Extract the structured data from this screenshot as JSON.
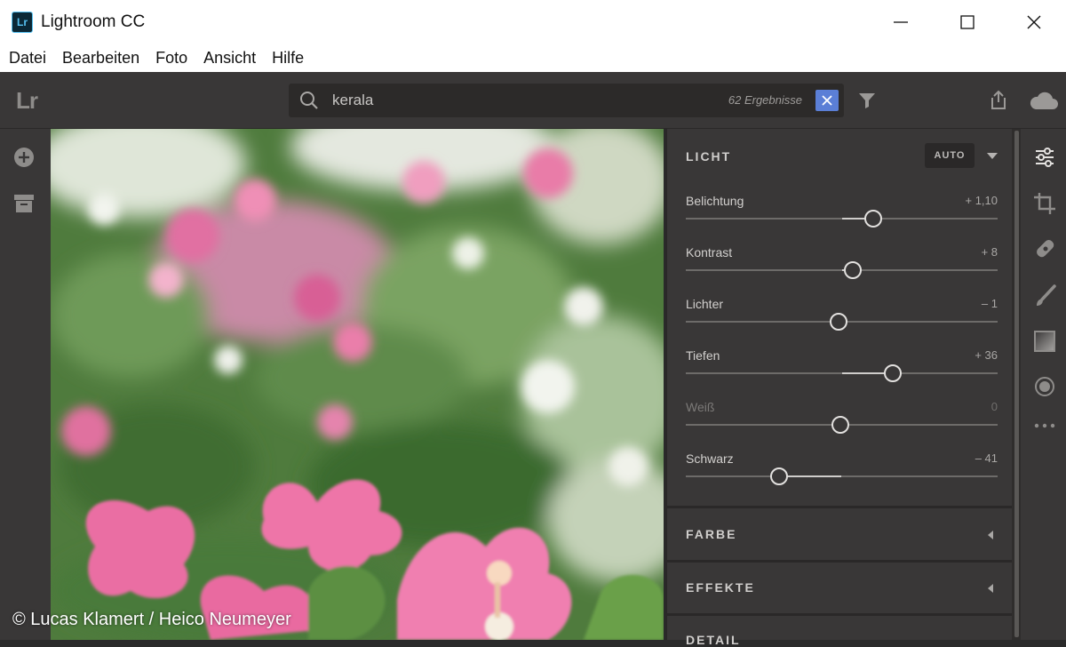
{
  "window": {
    "app_icon": "Lr",
    "title": "Lightroom CC",
    "controls": [
      "minimize-icon",
      "maximize-icon",
      "close-icon"
    ]
  },
  "menu": [
    "Datei",
    "Bearbeiten",
    "Foto",
    "Ansicht",
    "Hilfe"
  ],
  "toolbar": {
    "logo": "Lr",
    "search_value": "kerala",
    "result_count": "62 Ergebnisse",
    "icons": [
      "search-icon",
      "clear-icon",
      "filter-icon",
      "share-icon",
      "cloud-icon"
    ]
  },
  "left_sidebar": {
    "icons": [
      "add-icon",
      "archive-icon"
    ]
  },
  "photo": {
    "credit": "© Lucas Klamert / Heico Neumeyer"
  },
  "panel": {
    "licht": {
      "title": "LICHT",
      "auto_label": "AUTO",
      "sliders": [
        {
          "label": "Belichtung",
          "value": "+ 1,10",
          "position": 0.6
        },
        {
          "label": "Kontrast",
          "value": "+ 8",
          "position": 0.535
        },
        {
          "label": "Lichter",
          "value": "– 1",
          "position": 0.49
        },
        {
          "label": "Tiefen",
          "value": "+ 36",
          "position": 0.665
        },
        {
          "label": "Weiß",
          "value": "0",
          "position": 0.497
        },
        {
          "label": "Schwarz",
          "value": "– 41",
          "position": 0.3
        }
      ]
    },
    "sections": [
      "FARBE",
      "EFFEKTE",
      "DETAIL"
    ]
  },
  "right_toolbar": {
    "icons": [
      "edit-sliders-icon",
      "crop-icon",
      "healing-icon",
      "brush-icon",
      "linear-gradient-icon",
      "radial-gradient-icon",
      "more-icon"
    ]
  },
  "colors": {
    "panel_bg": "#393737",
    "accent_blue": "#5b7fd6",
    "lr_icon_blue": "#57c2f2"
  }
}
